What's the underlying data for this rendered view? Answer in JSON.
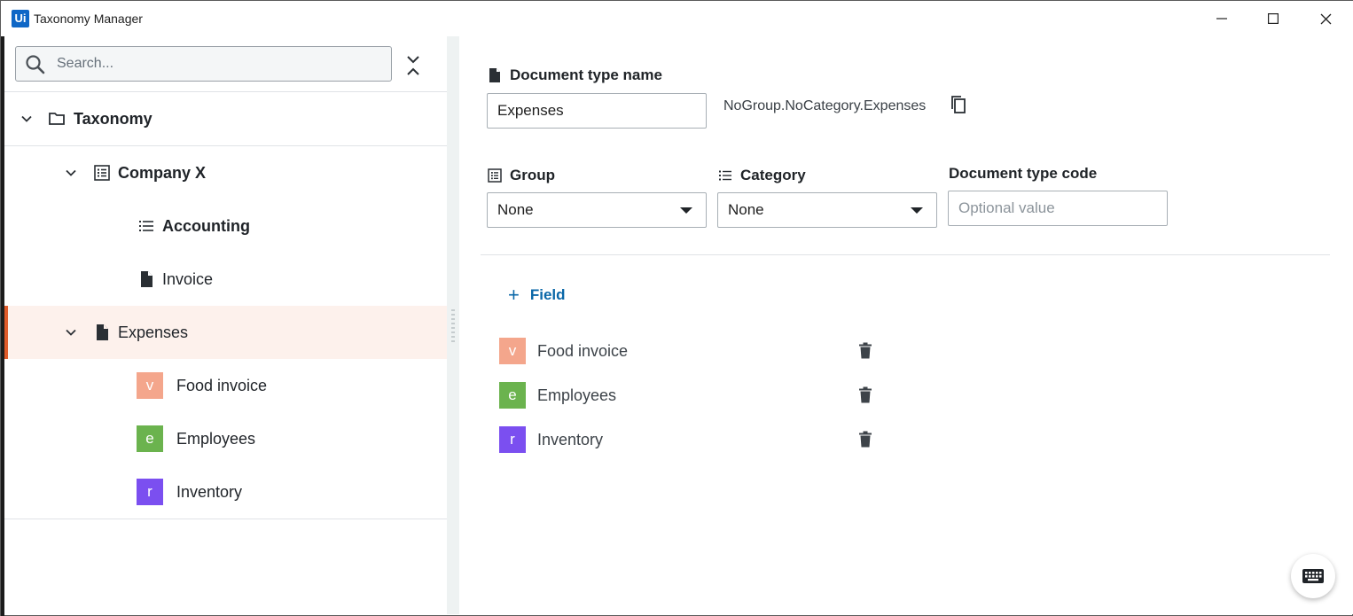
{
  "window": {
    "title": "Taxonomy Manager",
    "logo_text": "Ui",
    "logo_color": "#0f67c6"
  },
  "sidebar": {
    "search": {
      "placeholder": "Search...",
      "value": ""
    },
    "tree": {
      "root": {
        "label": "Taxonomy",
        "icon": "folder-icon",
        "expanded": true
      },
      "group": {
        "label": "Company X",
        "icon": "list-box-icon",
        "expanded": true
      },
      "category": {
        "label": "Accounting",
        "icon": "list-icon"
      },
      "doc_invoice": {
        "label": "Invoice",
        "icon": "document-icon"
      },
      "doc_expenses": {
        "label": "Expenses",
        "icon": "document-icon",
        "expanded": true,
        "selected": true
      },
      "fields": [
        {
          "badge": "v",
          "label": "Food invoice",
          "color": "#f4a68c"
        },
        {
          "badge": "e",
          "label": "Employees",
          "color": "#6bb34e"
        },
        {
          "badge": "r",
          "label": "Inventory",
          "color": "#7b4ff0"
        }
      ]
    }
  },
  "details": {
    "doc_type_name_label": "Document type name",
    "doc_type_name_value": "Expenses",
    "fully_qualified_name": "NoGroup.NoCategory.Expenses",
    "group_label": "Group",
    "group_value": "None",
    "category_label": "Category",
    "category_value": "None",
    "doc_type_code_label": "Document type code",
    "doc_type_code_placeholder": "Optional value",
    "add_field_label": "Field",
    "fields": [
      {
        "badge": "v",
        "label": "Food invoice",
        "color": "#f4a68c"
      },
      {
        "badge": "e",
        "label": "Employees",
        "color": "#6bb34e"
      },
      {
        "badge": "r",
        "label": "Inventory",
        "color": "#7b4ff0"
      }
    ]
  },
  "colors": {
    "accent_selected": "#e05b2a",
    "selected_row_bg": "#fdf1ec",
    "link": "#0a67a8"
  }
}
